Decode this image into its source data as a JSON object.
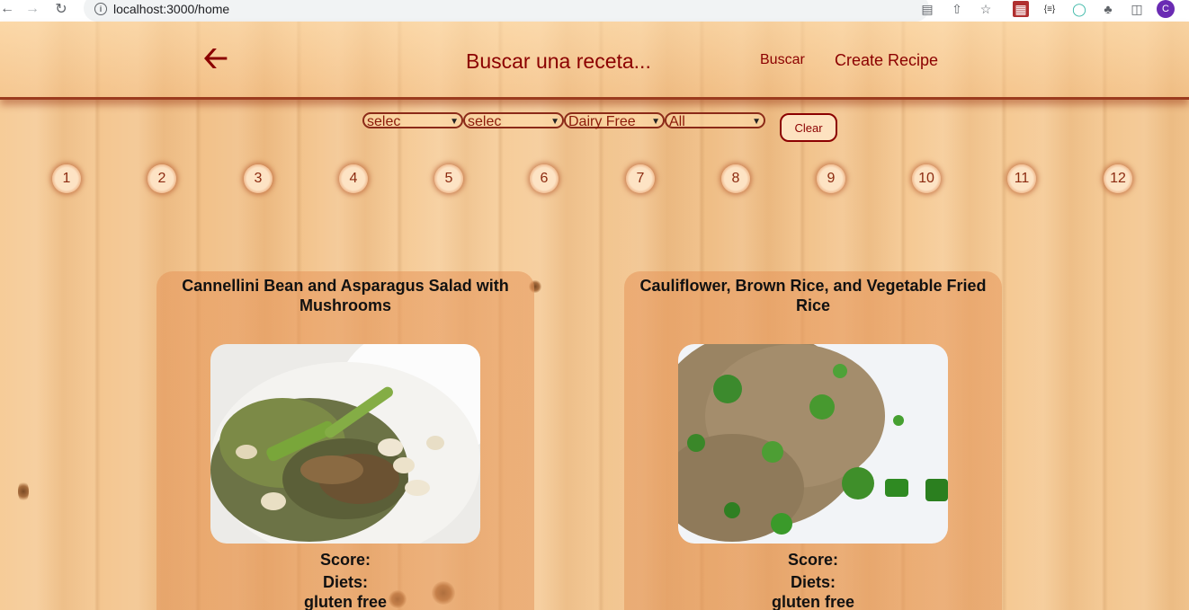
{
  "browser": {
    "url": "localhost:3000/home",
    "avatar_letter": "C"
  },
  "header": {
    "search_placeholder": "Buscar una receta...",
    "buscar_label": "Buscar",
    "create_label": "Create Recipe"
  },
  "filters": {
    "select1": "selec",
    "select2": "selec",
    "select3": "Dairy Free",
    "select4": "All",
    "clear_label": "Clear"
  },
  "pagination": [
    "1",
    "2",
    "3",
    "4",
    "5",
    "6",
    "7",
    "8",
    "9",
    "10",
    "11",
    "12"
  ],
  "recipes": [
    {
      "title": "Cannellini Bean and Asparagus Salad with Mushrooms",
      "score_label": "Score:",
      "diets_label": "Diets:",
      "diets": [
        "gluten free"
      ]
    },
    {
      "title": "Cauliflower, Brown Rice, and Vegetable Fried Rice",
      "score_label": "Score:",
      "diets_label": "Diets:",
      "diets": [
        "gluten free"
      ]
    }
  ]
}
